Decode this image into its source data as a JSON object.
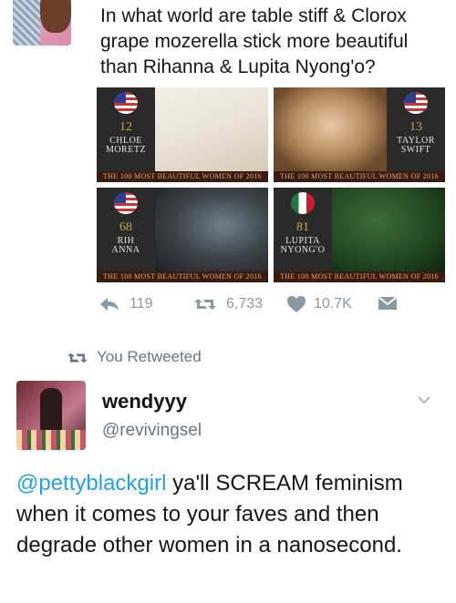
{
  "tweet1": {
    "text": "In what world are table stiff & Clorox grape mozerella stick more beautiful than Rihanna & Lupita Nyong'o?",
    "cards": [
      {
        "rank": "12",
        "name_line1": "CHLOE",
        "name_line2": "MORETZ",
        "banner": "THE 100 MOST BEAUTIFUL WOMEN OF 2016"
      },
      {
        "rank": "13",
        "name_line1": "TAYLOR",
        "name_line2": "SWIFT",
        "banner": "THE 100 MOST BEAUTIFUL WOMEN OF 2016"
      },
      {
        "rank": "68",
        "name_line1": "RIH",
        "name_line2": "ANNA",
        "banner": "THE 100 MOST BEAUTIFUL WOMEN OF 2016"
      },
      {
        "rank": "81",
        "name_line1": "LUPITA",
        "name_line2": "NYONG'O",
        "banner": "THE 100 MOST BEAUTIFUL WOMEN OF 2016"
      }
    ],
    "actions": {
      "replies": "119",
      "retweets": "6,733",
      "likes": "10.7K"
    }
  },
  "retweet_context": {
    "label": "You Retweeted"
  },
  "tweet2": {
    "display_name": "wendyyy",
    "handle": "@revivingsel",
    "mention": "@pettyblackgirl",
    "text": " ya'll SCREAM feminism when it comes to your faves and then degrade other women in a nanosecond."
  },
  "colors": {
    "link_blue": "#1da1f2",
    "muted_gray": "#8899a6",
    "text_dark": "#14171a"
  }
}
